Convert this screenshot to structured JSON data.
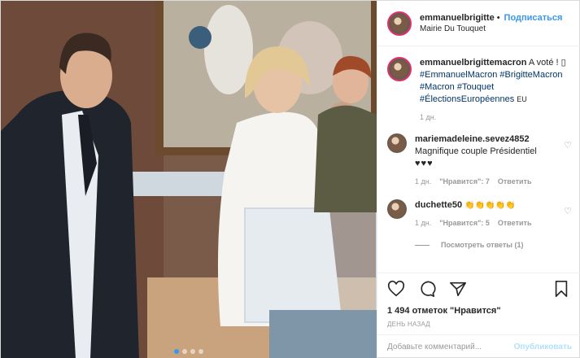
{
  "header": {
    "username": "emmanuelbrigitte",
    "separator": "•",
    "follow_label": "Подписаться",
    "location": "Mairie Du Touquet"
  },
  "caption": {
    "username": "emmanuelbrigittemacron",
    "text": "A voté ! ▯",
    "hashtags_line1": "#EmmanuelMacron #BrigitteMacron",
    "hashtags_line2_a": "#Macron",
    "hashtags_line2_b": "#Touquet",
    "hashtags_line3": "#ÉlectionsEuropéennes",
    "flag": "EU",
    "time": "1 дн."
  },
  "comments": [
    {
      "username": "mariemadeleine.sevez4852",
      "text": "Magnifique couple Présidentiel",
      "emoji": "♥♥♥",
      "time": "1 дн.",
      "likes": "\"Нравится\": 7",
      "reply": "Ответить"
    },
    {
      "username": "duchette50",
      "emoji": "👏👏👏👏👏",
      "time": "1 дн.",
      "likes": "\"Нравится\": 5",
      "reply": "Ответить",
      "view_replies": "Посмотреть ответы (1)"
    }
  ],
  "post": {
    "likes_text": "1 494 отметок \"Нравится\"",
    "posted": "ДЕНЬ НАЗАД",
    "comment_placeholder": "Добавьте комментарий...",
    "publish_label": "Опубликовать"
  },
  "carousel": {
    "count": 4,
    "active": 0
  },
  "colors": {
    "accent": "#3897f0",
    "text": "#262626",
    "muted": "#999999",
    "hashtag": "#003569"
  }
}
